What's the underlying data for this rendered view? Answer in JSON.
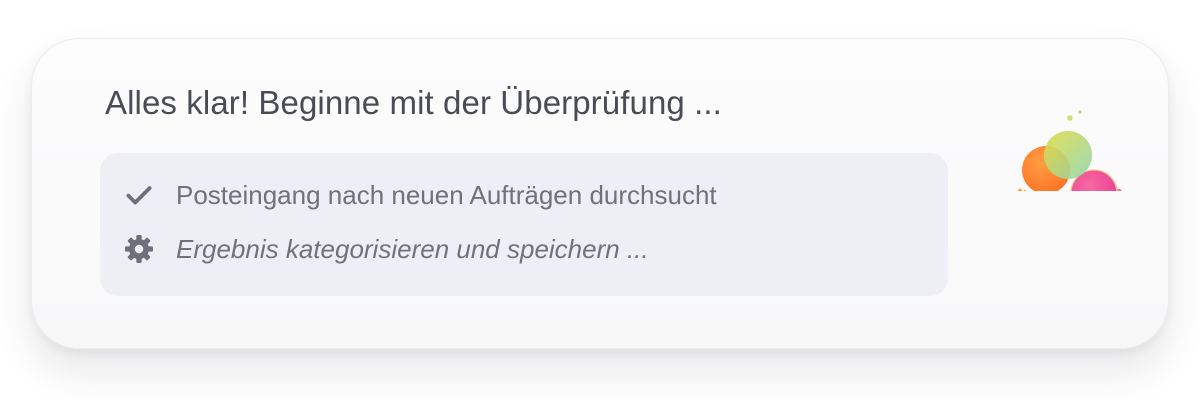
{
  "dialog": {
    "title": "Alles klar! Beginne mit der Überprüfung ...",
    "steps": [
      {
        "label": "Posteingang nach neuen Aufträgen durchsucht",
        "status": "done",
        "icon": "checkmark-icon"
      },
      {
        "label": "Ergebnis kategorisieren und speichern ...",
        "status": "in-progress",
        "icon": "gear-icon"
      }
    ],
    "logo": "colorful-bubbles-logo"
  },
  "colors": {
    "title_text": "#4a4c55",
    "step_text": "#6f717c",
    "panel_background": "#eeeff4",
    "icon": "#6d6f7a",
    "bubble_orange": "#ff7a1a",
    "bubble_yellow_green": "#c8da5a",
    "bubble_pink": "#f0409a"
  }
}
